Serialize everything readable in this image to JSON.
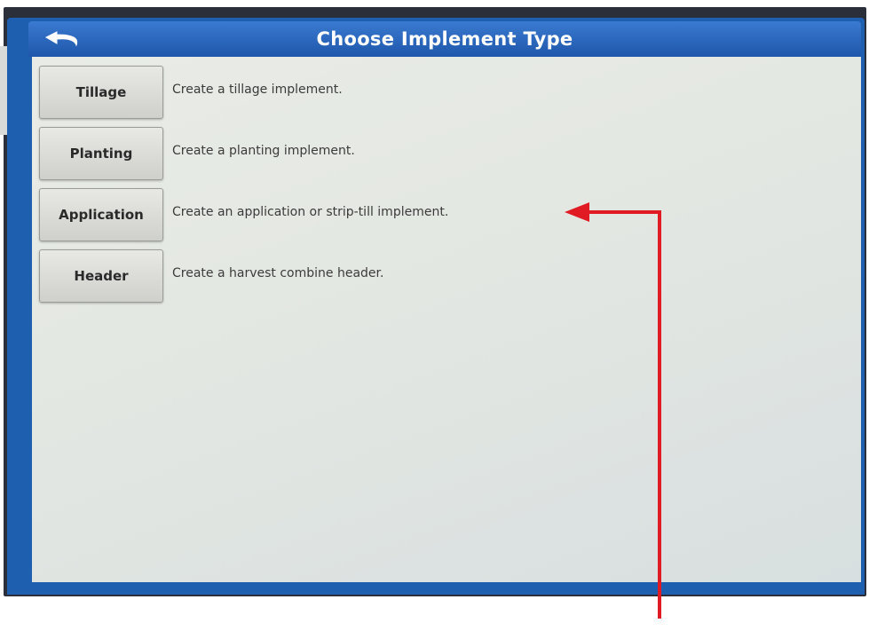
{
  "header": {
    "title": "Choose Implement Type",
    "back_icon": "undo-arrow-icon"
  },
  "implement_types": [
    {
      "label": "Tillage",
      "description": "Create a tillage implement."
    },
    {
      "label": "Planting",
      "description": "Create a planting implement."
    },
    {
      "label": "Application",
      "description": "Create an application or strip-till implement."
    },
    {
      "label": "Header",
      "description": "Create a harvest combine header."
    }
  ],
  "annotation": {
    "icon": "red-callout-arrow",
    "color": "#e01b24",
    "target": "Application"
  },
  "colors": {
    "title_bar": "#1e57ab",
    "content_bg": "#e6e9e4",
    "button_bg": "#d9d9d5"
  }
}
